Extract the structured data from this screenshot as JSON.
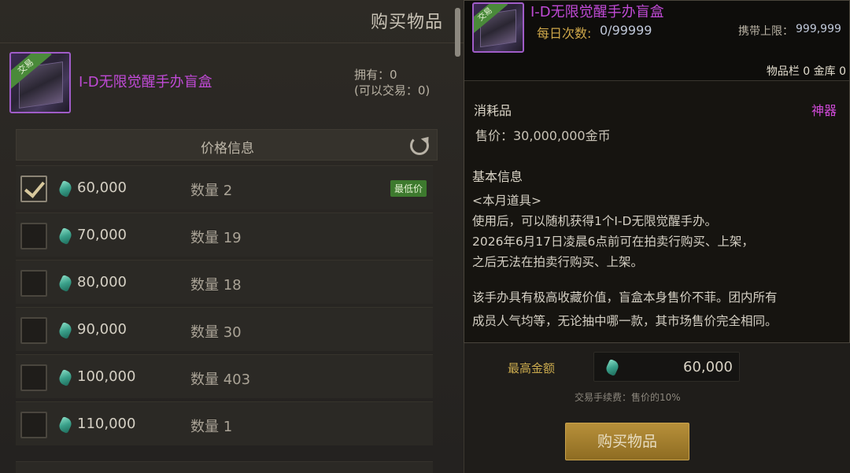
{
  "left_panel": {
    "title": "购买物品",
    "item_name": "I-D无限觉醒手办盲盒",
    "trade_tag": "交易",
    "owned": "拥有：0",
    "tradable": "(可以交易：0)",
    "price_header": "价格信息",
    "lowest_badge": "最低价",
    "listings": [
      {
        "price": "60,000",
        "qty": "数量 2",
        "checked": true
      },
      {
        "price": "70,000",
        "qty": "数量 19",
        "checked": false
      },
      {
        "price": "80,000",
        "qty": "数量 18",
        "checked": false
      },
      {
        "price": "90,000",
        "qty": "数量 30",
        "checked": false
      },
      {
        "price": "100,000",
        "qty": "数量 403",
        "checked": false
      },
      {
        "price": "110,000",
        "qty": "数量 1",
        "checked": false
      }
    ]
  },
  "purchase": {
    "max_amount_label": "最高金额",
    "max_amount_value": "60,000",
    "fee_note": "交易手续费：售价的10%",
    "buy_button": "购买物品"
  },
  "tooltip": {
    "item_name": "I-D无限觉醒手办盲盒",
    "trade_tag": "交易",
    "daily_label": "每日次数:",
    "daily_value": "0/99999",
    "carry_limit_label": "携带上限：",
    "carry_limit_value": "999,999",
    "storage": "物品栏 0 金库 0",
    "category": "消耗品",
    "rarity": "神器",
    "sell_price": "售价：30,000,000金币",
    "basic_info_title": "基本信息",
    "lines": [
      "<本月道具>",
      "使用后，可以随机获得1个I-D无限觉醒手办。",
      "2026年6月17日凌晨6点前可在拍卖行购买、上架，",
      "之后无法在拍卖行购买、上架。",
      "该手办具有极高收藏价值，盲盒本身售价不菲。团内所有",
      "成员人气均等，无论抽中哪一款，其市场售价完全相同。"
    ]
  }
}
